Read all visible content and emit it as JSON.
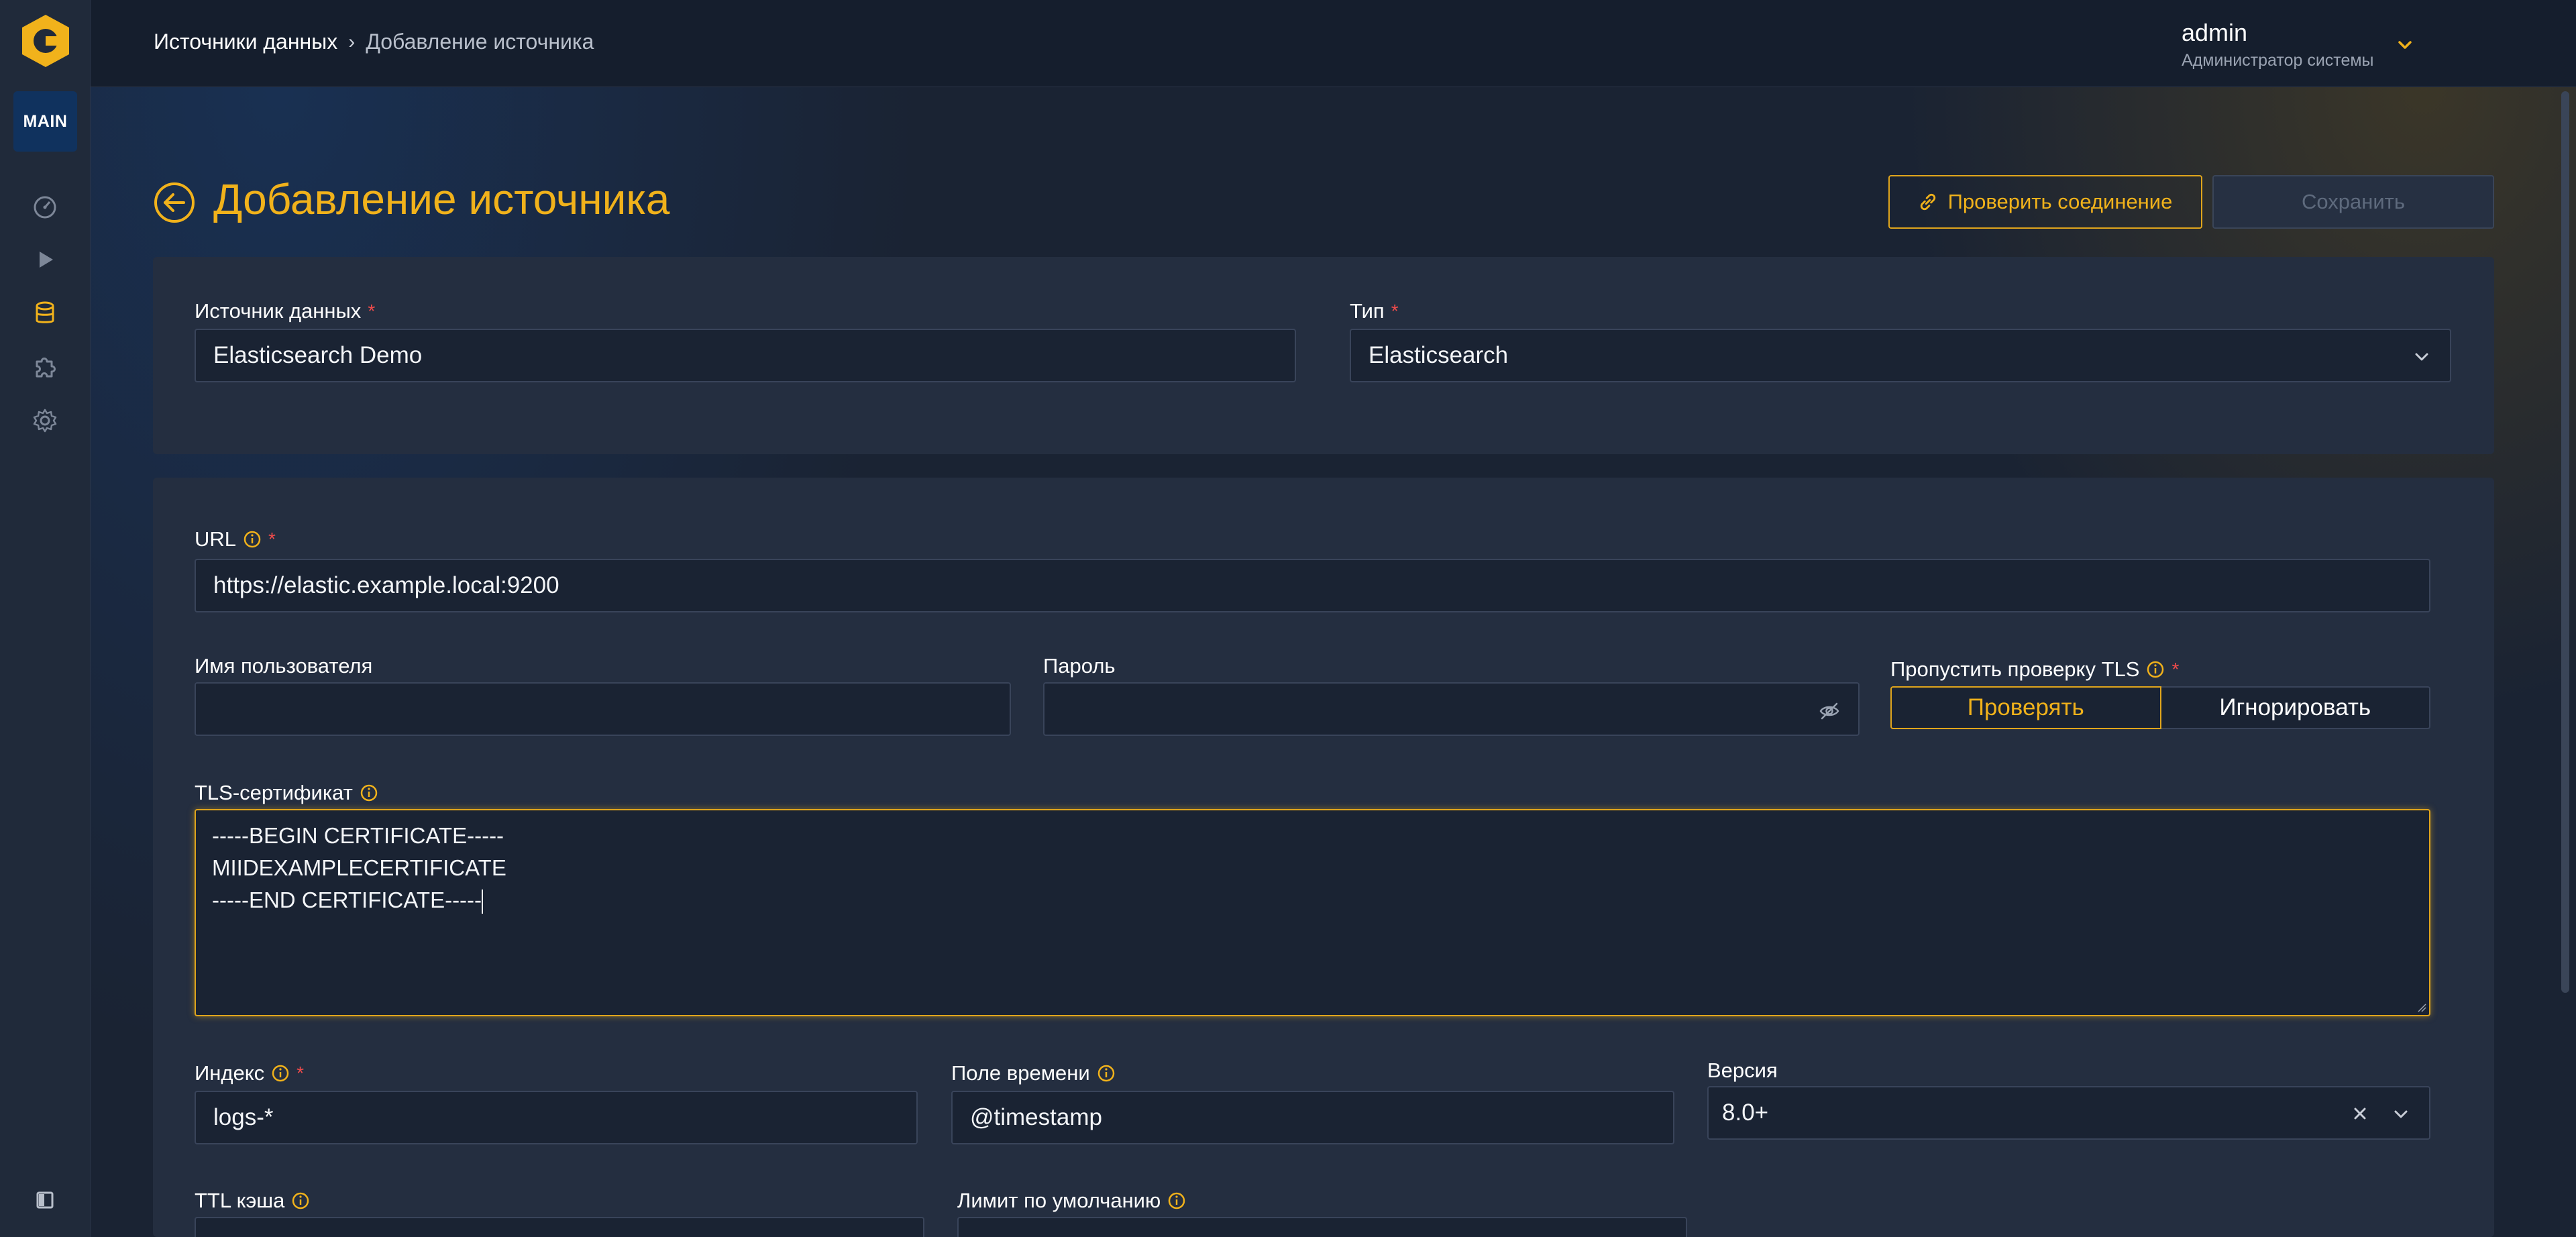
{
  "sidebar": {
    "badge": "MAIN",
    "items": [
      {
        "icon": "dashboard-icon"
      },
      {
        "icon": "play-icon"
      },
      {
        "icon": "database-icon",
        "active": true
      },
      {
        "icon": "puzzle-icon"
      },
      {
        "icon": "gear-icon"
      }
    ],
    "collapse_icon": "sidebar-collapse-icon"
  },
  "header": {
    "breadcrumb": {
      "link": "Источники данных",
      "current": "Добавление источника"
    },
    "user": {
      "name": "admin",
      "role": "Администратор системы"
    }
  },
  "page": {
    "title": "Добавление источника",
    "buttons": {
      "check": "Проверить соединение",
      "save": "Сохранить"
    }
  },
  "form": {
    "source_name": {
      "label": "Источник данных",
      "value": "Elasticsearch Demo"
    },
    "type": {
      "label": "Тип",
      "value": "Elasticsearch"
    },
    "url": {
      "label": "URL",
      "value": "https://elastic.example.local:9200"
    },
    "username": {
      "label": "Имя пользователя",
      "value": ""
    },
    "password": {
      "label": "Пароль",
      "value": ""
    },
    "skip_tls": {
      "label": "Пропустить проверку TLS",
      "options": [
        "Проверять",
        "Игнорировать"
      ],
      "selected": "Проверять"
    },
    "tls_cert": {
      "label": "TLS-сертификат",
      "lines": [
        "-----BEGIN CERTIFICATE-----",
        "MIIDEXAMPLECERTIFICATE",
        "-----END CERTIFICATE-----"
      ]
    },
    "index": {
      "label": "Индекс",
      "value": "logs-*"
    },
    "time_field": {
      "label": "Поле времени",
      "value": "@timestamp"
    },
    "version": {
      "label": "Версия",
      "value": "8.0+"
    },
    "cache_ttl": {
      "label": "TTL кэша"
    },
    "default_limit": {
      "label": "Лимит по умолчанию"
    }
  },
  "colors": {
    "accent": "#f1b21b",
    "required": "#ef4b4b",
    "background": "#1a2333",
    "panel": "#242e40"
  }
}
